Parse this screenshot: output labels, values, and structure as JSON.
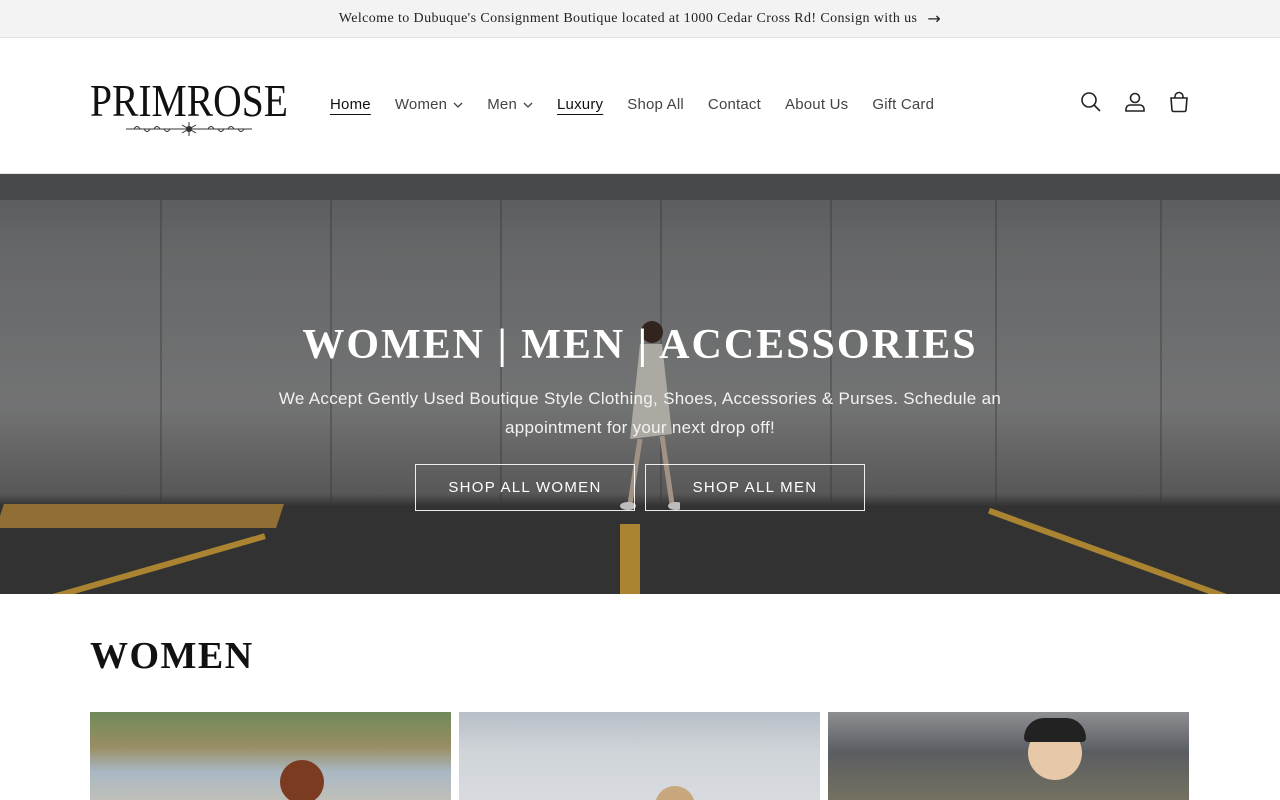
{
  "announcement": {
    "text": "Welcome to Dubuque's Consignment Boutique located at 1000 Cedar Cross Rd! Consign with us",
    "arrow_icon": "arrow-right-icon"
  },
  "header": {
    "logo_text": "PRIMROSE",
    "nav": [
      {
        "label": "Home",
        "active": true
      },
      {
        "label": "Women",
        "dropdown": true
      },
      {
        "label": "Men",
        "dropdown": true
      },
      {
        "label": "Luxury",
        "underline": true
      },
      {
        "label": "Shop All"
      },
      {
        "label": "Contact"
      },
      {
        "label": "About Us"
      },
      {
        "label": "Gift Card"
      }
    ],
    "icons": [
      "search-icon",
      "account-icon",
      "cart-icon"
    ]
  },
  "hero": {
    "title": "WOMEN | MEN | ACCESSORIES",
    "subtitle": "We Accept Gently Used Boutique Style Clothing, Shoes, Accessories & Purses. Schedule an appointment for your next drop off!",
    "buttons": [
      "SHOP ALL WOMEN",
      "SHOP ALL MEN"
    ]
  },
  "section": {
    "title": "WOMEN"
  },
  "colors": {
    "announcement_bg": "#f3f3f3",
    "text": "#1a1a1a",
    "hero_overlay": "#000000",
    "parking_stripe": "#d6a53a"
  }
}
